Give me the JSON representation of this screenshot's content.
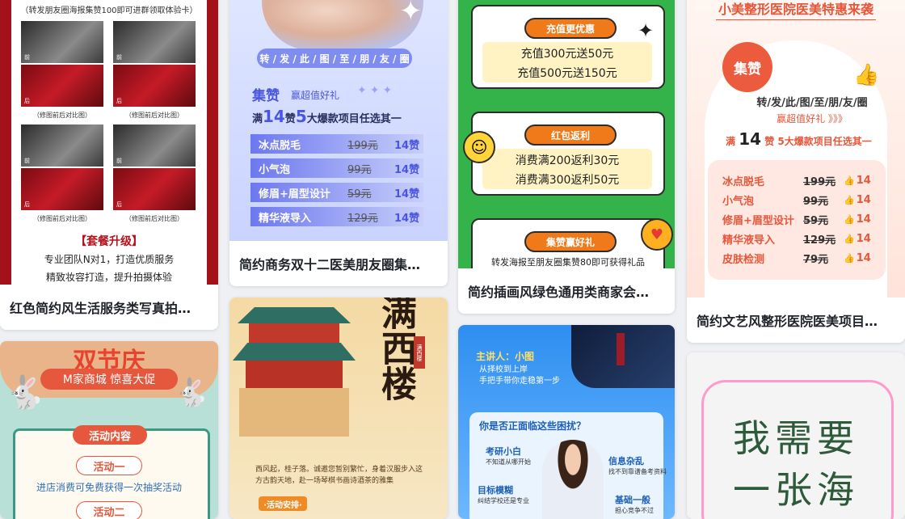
{
  "cards": [
    {
      "title": "红色简约风生活服务类写真拍…",
      "texts": {
        "top_note": "（转发朋友圈海报集赞100即可进群领取体验卡）",
        "before1": "前",
        "after1": "后",
        "before2": "前",
        "after2": "后",
        "before3": "前",
        "after3": "后",
        "before4": "前",
        "after4": "后",
        "compare1": "（修图前后对比图）",
        "compare2": "（修图前后对比图）",
        "compare3": "（修图前后对比图）",
        "compare4": "（修图前后对比图）",
        "upgrade": "【套餐升级】",
        "line1": "专业团队N对1，打造优质服务",
        "line2": "精致妆容打造，提升拍摄体验"
      }
    },
    {
      "title": "简约商务双十二医美朋友圈集…",
      "texts": {
        "share": "转 / 发 / 此 / 图 / 至 / 朋 / 友 / 圈",
        "jizan": "集赞",
        "win": "赢超值好礼",
        "full_pre": "满",
        "full_num": "14",
        "full_mid": "赞",
        "full_num2": "5",
        "full_post": "大爆款项目任选其一",
        "items": [
          {
            "name": "冰点脱毛",
            "price": "199元",
            "likes": "14赞"
          },
          {
            "name": "小气泡",
            "price": "99元",
            "likes": "14赞"
          },
          {
            "name": "修眉+眉型设计",
            "price": "59元",
            "likes": "14赞"
          },
          {
            "name": "精华液导入",
            "price": "129元",
            "likes": "14赞"
          }
        ]
      }
    },
    {
      "title": "简约插画风绿色通用类商家会…",
      "texts": {
        "tag1": "充值更优惠",
        "r1": "充值300元送50元",
        "r2": "充值500元送150元",
        "tag2": "红包返利",
        "r3": "消费满200返利30元",
        "r4": "消费满300返利50元",
        "tag3": "集赞赢好礼",
        "r5": "转发海报至朋友圈集赞80即可获得礼品"
      }
    },
    {
      "title": "简约文艺风整形医院医美项目…",
      "texts": {
        "top": "小美整形医院医美特惠来袭",
        "badge": "集赞",
        "share": "转/发/此/图/至/朋/友/圈",
        "win": "赢超值好礼 》》》",
        "full_pre": "满",
        "full_num": "14",
        "full_post": "赞  5大爆款项目任选其一",
        "items": [
          {
            "name": "冰点脱毛",
            "price": "199元",
            "likes": "14"
          },
          {
            "name": "小气泡",
            "price": "99元",
            "likes": "14"
          },
          {
            "name": "修眉+眉型设计",
            "price": "59元",
            "likes": "14"
          },
          {
            "name": "精华液导入",
            "price": "129元",
            "likes": "14"
          },
          {
            "name": "皮肤检测",
            "price": "79元",
            "likes": "14"
          }
        ]
      }
    },
    {
      "texts": {
        "headline": "双节庆",
        "sub": "M家商城 惊喜大促",
        "section": "活动内容",
        "act1": "活动一",
        "act1_desc": "进店消费可免费获得一次抽奖活动",
        "act2": "活动二"
      }
    },
    {
      "texts": {
        "title": "满西楼",
        "seal": "满西楼",
        "para": "西风起，桂子落。诚邀您暂别繁忙，身着汉服步入这方古韵天地，赴一场琴棋书画诗酒茶的雅集",
        "tag": "·活动安排·"
      }
    },
    {
      "texts": {
        "speaker": "主讲人：小图",
        "speaker_sub": "从择校到上岸",
        "speaker_sub2": "手把手带你走稳第一步",
        "question": "你是否正面临这些困扰？",
        "q1": "考研小白",
        "q1d": "不知道从哪开始",
        "q2": "信息杂乱",
        "q2d": "找不到靠谱备考资料",
        "q3": "目标模糊",
        "q3d": "纠结学校还是专业",
        "q4": "基础一般",
        "q4d": "担心竞争不过"
      }
    },
    {
      "texts": {
        "line1": "我需要",
        "line2": "一张海"
      }
    }
  ]
}
